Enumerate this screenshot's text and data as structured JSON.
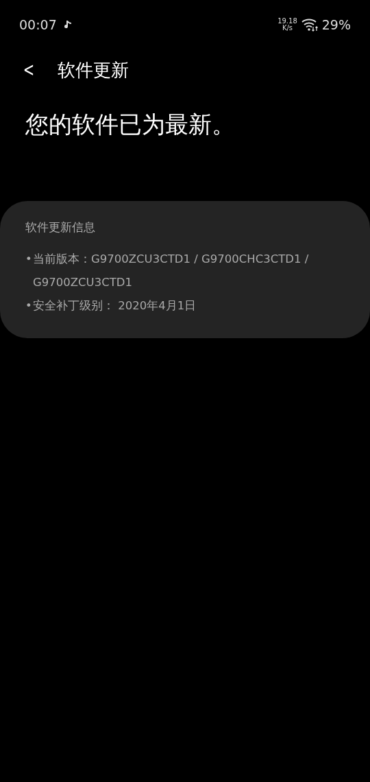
{
  "status_bar": {
    "time": "00:07",
    "speed_value": "19.18",
    "speed_unit": "K/s",
    "battery": "29%"
  },
  "header": {
    "back": "<",
    "title": "软件更新"
  },
  "headline": "您的软件已为最新。",
  "info_card": {
    "title": "软件更新信息",
    "items": [
      {
        "bullet": "•",
        "text": "当前版本：G9700ZCU3CTD1 / G9700CHC3CTD1 / G9700ZCU3CTD1"
      },
      {
        "bullet": "•",
        "text": "安全补丁级别： 2020年4月1日"
      }
    ]
  }
}
